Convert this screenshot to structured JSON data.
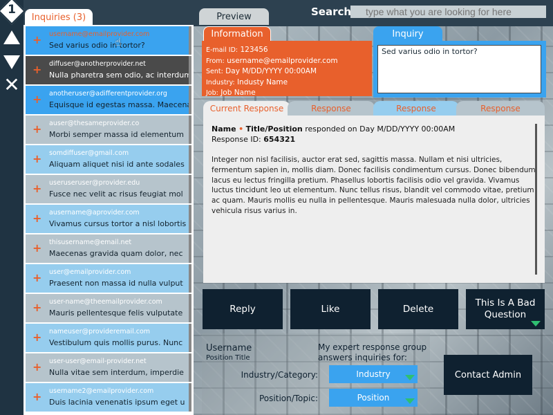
{
  "app": {
    "badge_number": "1"
  },
  "colors": {
    "orange": "#e8602c",
    "blue": "#3aa3ef",
    "navy": "#0f2130",
    "light_blue": "#96cdee",
    "grey": "#b6c4cc",
    "green": "#2fbf71"
  },
  "controls": {
    "up_icon": "triangle-up",
    "down_icon": "triangle-down",
    "close_icon": "close-x"
  },
  "inquiries": {
    "tab_label": "Inquiries (3)",
    "items": [
      {
        "email": "username@emailprovider.com",
        "snippet": "Sed varius odio in tortor?",
        "style": "blue",
        "highlight": true
      },
      {
        "email": "diffuser@anotherprovider.net",
        "snippet": "Nulla pharetra sem odio, ac interdum",
        "style": "dark",
        "highlight": false
      },
      {
        "email": "anotheruser@adifferentprovider.org",
        "snippet": "Equisque id egestas massa. Maecenas",
        "style": "blue",
        "highlight": false
      },
      {
        "email": "auser@thesameprovider.co",
        "snippet": "Morbi semper massa id elementum",
        "style": "grey",
        "highlight": false
      },
      {
        "email": "somdiffuser@gmail.com",
        "snippet": "Aliquam aliquet nisi id ante sodales",
        "style": "light",
        "highlight": false
      },
      {
        "email": "useruseruser@provider.edu",
        "snippet": "Fusce nec velit ac risus feugiat mol",
        "style": "grey",
        "highlight": false
      },
      {
        "email": "ausername@aprovider.com",
        "snippet": "Vivamus cursus tortor a nisl lobortis",
        "style": "light",
        "highlight": false
      },
      {
        "email": "thisusername@email.net",
        "snippet": "Maecenas gravida quam dolor, nec",
        "style": "grey",
        "highlight": false
      },
      {
        "email": "user@emailprovider.com",
        "snippet": "Praesent non massa id nulla vulput",
        "style": "light",
        "highlight": false
      },
      {
        "email": "user-name@theemailprovider.com",
        "snippet": "Mauris pellentesque felis vulputate",
        "style": "grey",
        "highlight": false
      },
      {
        "email": "nameuser@provideremail.com",
        "snippet": "Vestibulum quis mollis purus. Nunc",
        "style": "light",
        "highlight": false
      },
      {
        "email": "user-user@email-provider.net",
        "snippet": "Nulla vitae sem interdum, imperdie",
        "style": "grey",
        "highlight": false
      },
      {
        "email": "username2@emailprovider.com",
        "snippet": "Duis lacinia venenatis ipsum eget u",
        "style": "light",
        "highlight": false
      }
    ]
  },
  "search": {
    "label": "Search:",
    "placeholder": "type what you are looking for here"
  },
  "preview": {
    "tab_label": "Preview"
  },
  "information": {
    "tab_label": "Information",
    "email_label": "E-mail ID:",
    "email_value": "123456",
    "from_label": "From:",
    "from_value": "username@emailprovider.com",
    "sent_label": "Sent:",
    "sent_value": "Day M/DD/YYYY 00:00AM",
    "industry_label": "Industry:",
    "industry_value": "Industy Name",
    "job_label": "Job:",
    "job_value": "Job Name"
  },
  "inquiry": {
    "tab_label": "Inquiry",
    "text": "Sed varius odio in tortor?"
  },
  "responses": {
    "tabs": [
      "Current Response",
      "Response",
      "Response",
      "Response"
    ],
    "name": "Name",
    "dot": "•",
    "title_position": "Title/Position",
    "responded_text": "responded on Day M/DD/YYYY 00:00AM",
    "id_label": "Response ID:",
    "id_value": "654321",
    "body": "Integer non nisl facilisis, auctor erat sed, sagittis massa. Nullam et nisi ultricies, fermentum sapien in, mollis diam. Donec facilisis condimentum cursus. Donec bibendum lacus eu lectus fringilla pretium. Phasellus lobortis facilisis odio vel gravida. Vivamus luctus tincidunt leo ut elementum. Nunc tellus risus, blandit vel commodo vitae, pretium ac quam. Mauris mollis eu nulla in pellentesque. Mauris malesuada nulla dolor, ultricies vehicula risus varius in."
  },
  "actions": {
    "reply": "Reply",
    "like": "Like",
    "delete": "Delete",
    "bad_question": "This Is A Bad Question"
  },
  "profile": {
    "username": "Username",
    "position_title": "Position Title",
    "expert_text": "My expert response group answers inquiries for:",
    "industry_label": "Industry/Category:",
    "industry_value": "Industry",
    "position_label": "Position/Topic:",
    "position_value": "Position",
    "contact_admin": "Contact Admin"
  }
}
